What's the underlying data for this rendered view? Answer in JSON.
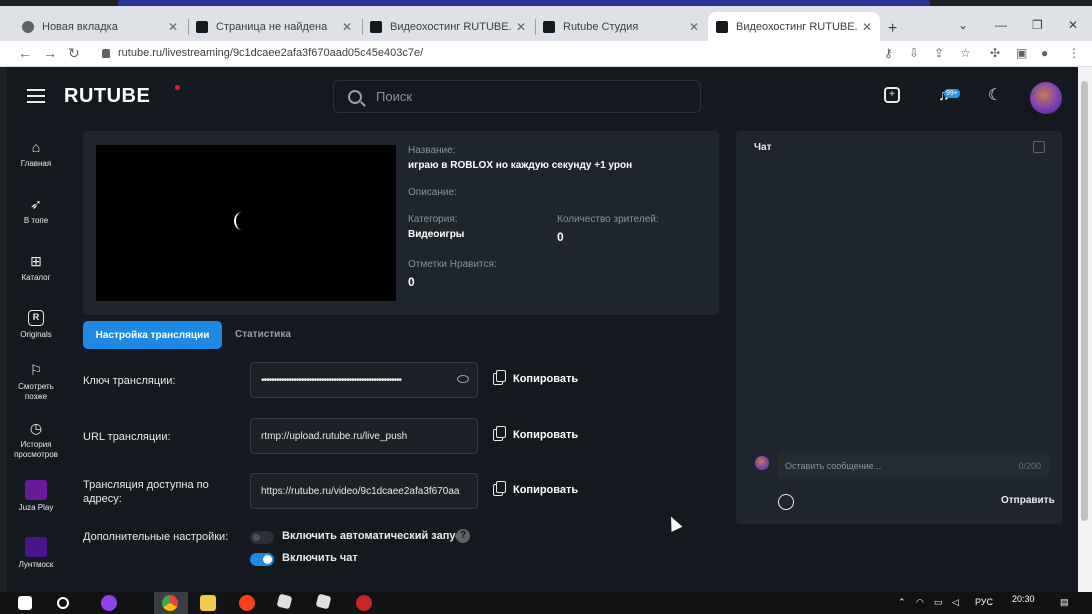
{
  "browser": {
    "tabs": [
      {
        "title": "Новая вкладка",
        "active": false
      },
      {
        "title": "Страница не найдена",
        "active": false
      },
      {
        "title": "Видеохостинг RUTUBE. Смо",
        "active": false
      },
      {
        "title": "Rutube Студия",
        "active": false
      },
      {
        "title": "Видеохостинг RUTUBE. Смо",
        "active": true
      }
    ],
    "url": "rutube.ru/livestreaming/9c1dcaee2afa3f670aad05c45e403c7e/"
  },
  "header": {
    "logo": "RUTUBE",
    "search_placeholder": "Поиск",
    "notification_badge": "99+"
  },
  "sidebar": {
    "items": [
      {
        "label": "Главная",
        "icon": "home-icon"
      },
      {
        "label": "В топе",
        "icon": "rocket-icon"
      },
      {
        "label": "Каталог",
        "icon": "grid-icon"
      },
      {
        "label": "Originals",
        "icon": "originals-icon"
      },
      {
        "label": "Смотреть позже",
        "icon": "bookmark-icon"
      },
      {
        "label": "История просмотров",
        "icon": "history-icon"
      },
      {
        "label": "Juza Play",
        "icon": "channel-avatar"
      },
      {
        "label": "Лунтмоск",
        "icon": "channel-avatar"
      }
    ]
  },
  "stream": {
    "name_label": "Название:",
    "name_value": "играю в ROBLOX но каждую секунду +1 урон",
    "description_label": "Описание:",
    "category_label": "Категория:",
    "category_value": "Видеоигры",
    "viewers_label": "Количество зрителей:",
    "viewers_value": "0",
    "likes_label": "Отметки Нравится:",
    "likes_value": "0"
  },
  "tabs": {
    "settings": "Настройка трансляции",
    "stats": "Статистика"
  },
  "form": {
    "key_label": "Ключ трансляции:",
    "key_value": "••••••••••••••••••••••••••••••••••••••••••••••••••••••••",
    "url_label": "URL трансляции:",
    "url_value": "rtmp://upload.rutube.ru/live_push",
    "address_label": "Трансляция доступна по адресу:",
    "address_value": "https://rutube.ru/video/9c1dcaee2afa3f670aa",
    "copy_label": "Копировать",
    "extra_label": "Дополнительные настройки:",
    "autostart_label": "Включить автоматический запуск",
    "autostart_on": false,
    "chat_label": "Включить чат",
    "chat_on": true
  },
  "chat": {
    "title": "Чат",
    "input_placeholder": "Оставить сообщение...",
    "counter": "0/200",
    "send_label": "Отправить"
  },
  "taskbar": {
    "lang": "РУС",
    "time": "20:30"
  }
}
